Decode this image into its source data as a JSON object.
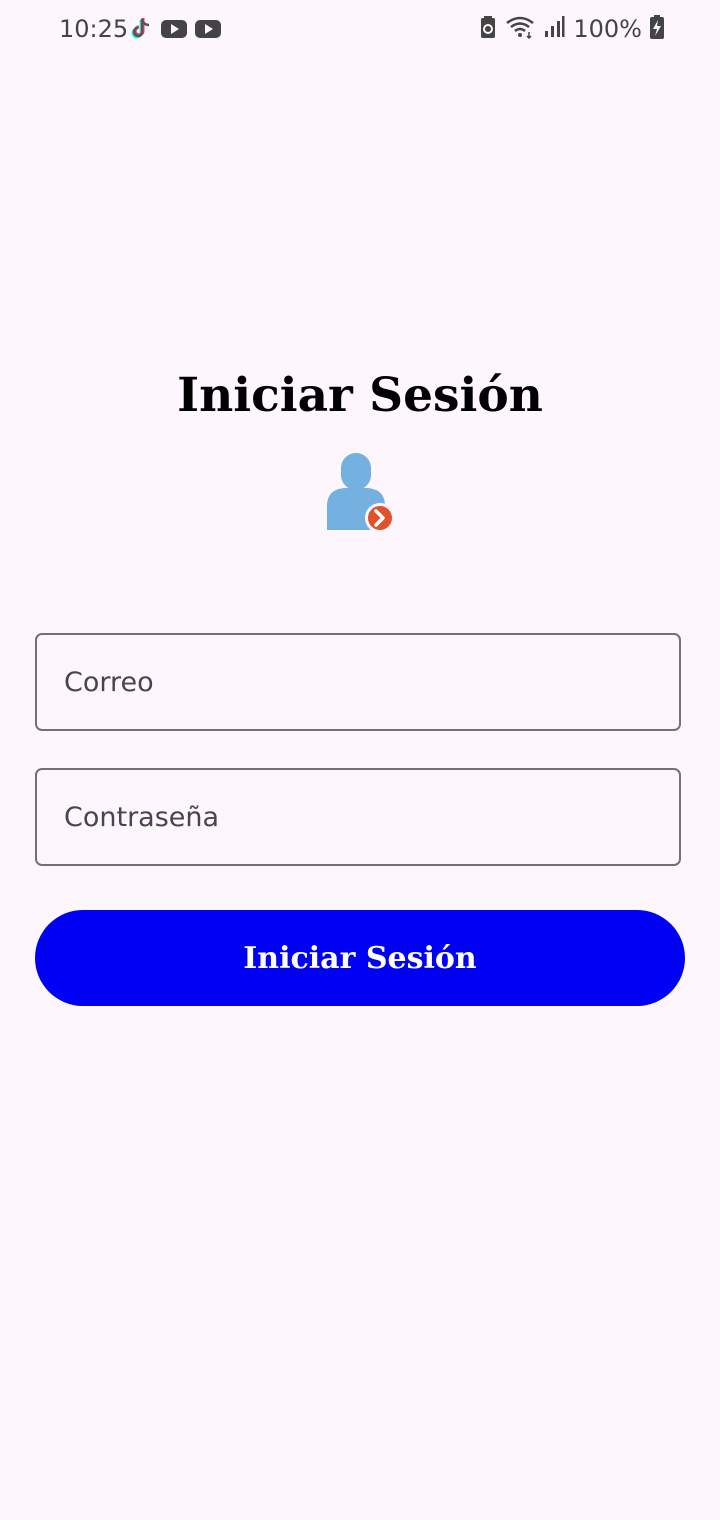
{
  "status_bar": {
    "time": "10:25",
    "battery_percent": "100%",
    "left_icons": [
      "tiktok-icon",
      "youtube-icon",
      "youtube-icon"
    ],
    "right_icons": [
      "battery-saver-icon",
      "wifi-icon",
      "signal-icon",
      "battery-charging-icon"
    ]
  },
  "login": {
    "title": "Iniciar Sesión",
    "icon": "user-login-icon",
    "email_placeholder": "Correo",
    "password_placeholder": "Contraseña",
    "submit_label": "Iniciar Sesión"
  },
  "colors": {
    "background": "#fdf7fd",
    "button": "#0000f5",
    "user_icon": "#74b0e0",
    "badge": "#e0522a"
  }
}
